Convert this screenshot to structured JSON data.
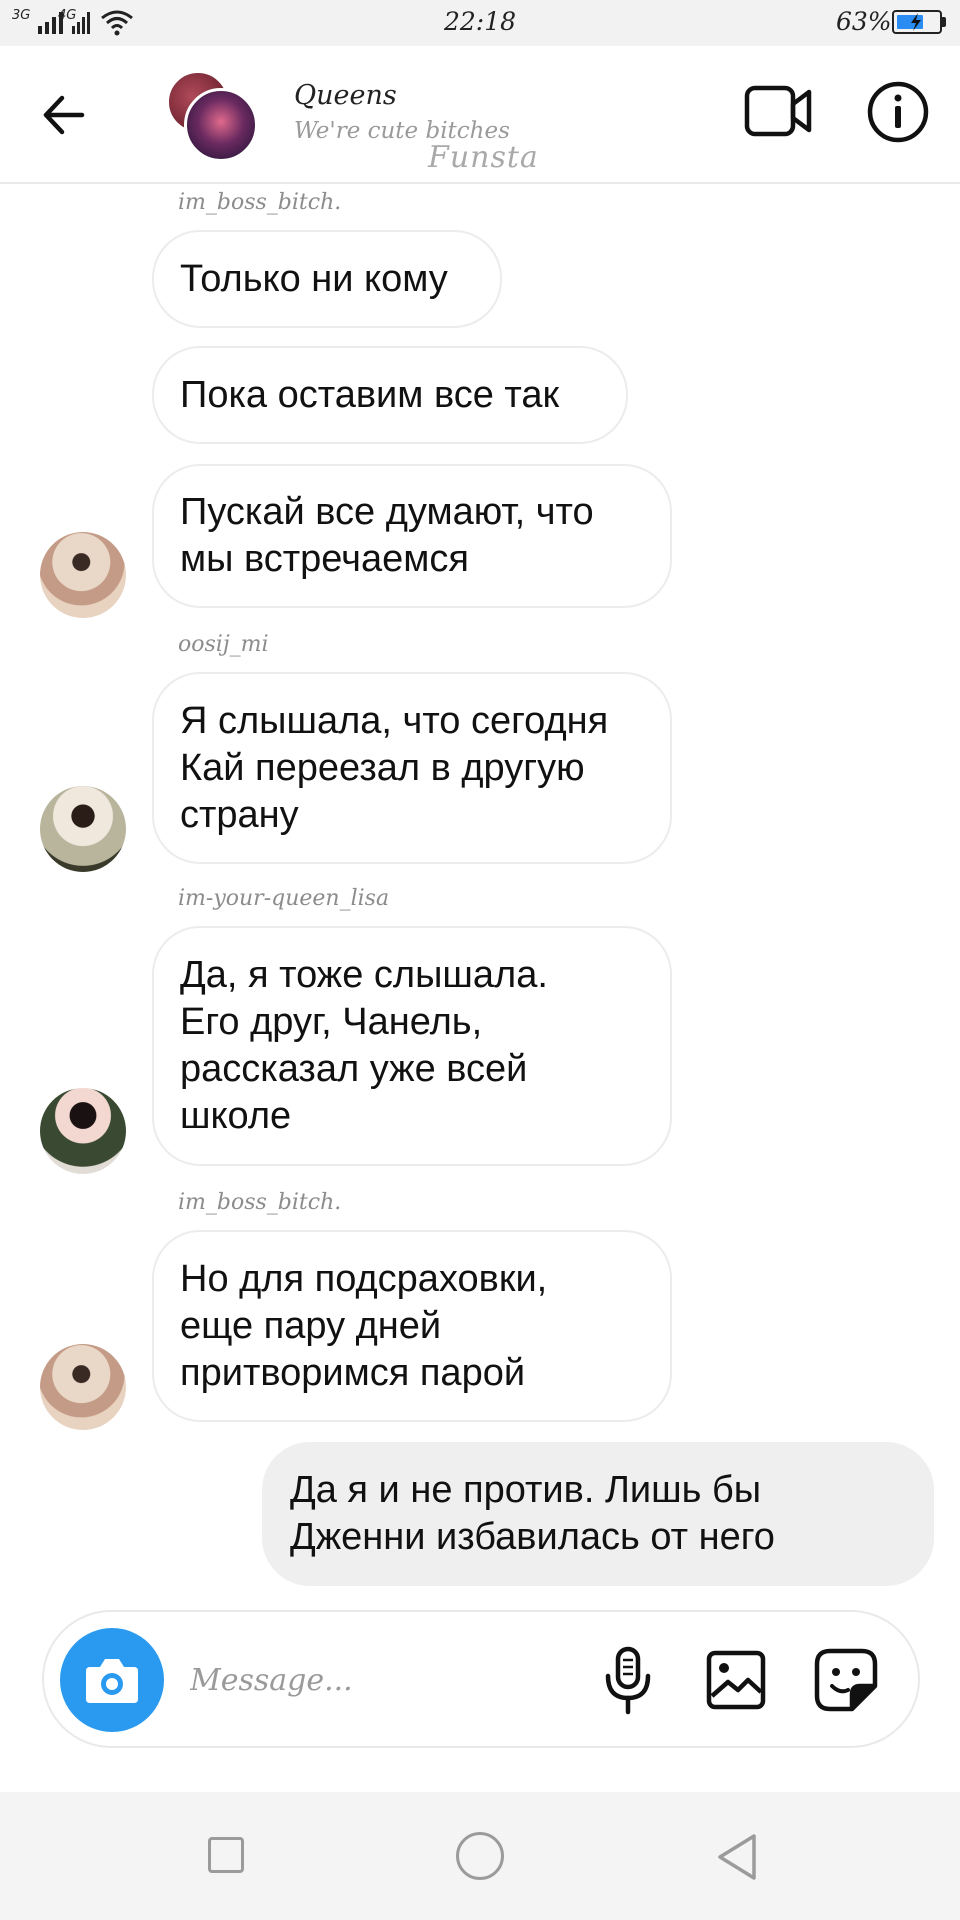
{
  "status_bar": {
    "network_1": "3G",
    "network_2": "4G",
    "time": "22:18",
    "battery_percent": "63%",
    "battery_level": 0.63
  },
  "header": {
    "title": "Queens",
    "subtitle": "We're cute bitches",
    "watermark": "Funsta"
  },
  "messages": [
    {
      "type": "sender",
      "text": "im_boss_bitch."
    },
    {
      "type": "bubble",
      "text": "Только ни кому"
    },
    {
      "type": "bubble",
      "text": "Пока оставим все так"
    },
    {
      "type": "bubble",
      "text": "Пускай все думают, что\nмы встречаемся"
    },
    {
      "type": "sender",
      "text": "oosij_mi"
    },
    {
      "type": "bubble",
      "text": "Я слышала, что сегодня\nКай переезал в другую\nстрану"
    },
    {
      "type": "sender",
      "text": "im-your-queen_lisa"
    },
    {
      "type": "bubble",
      "text": "Да, я тоже слышала.\nЕго друг, Чанель,\nрассказал уже всей\nшколе"
    },
    {
      "type": "sender",
      "text": "im_boss_bitch."
    },
    {
      "type": "bubble",
      "text": "Но для подсраховки,\nеще пару дней\nпритворимся парой"
    },
    {
      "type": "bubble_out",
      "text": "Да я и не против. Лишь бы\nДженни избавилась от него"
    }
  ],
  "composer": {
    "placeholder": "Message..."
  },
  "colors": {
    "accent": "#2a9af0",
    "bubble_in_border": "#ececec",
    "bubble_out_bg": "#efefef"
  },
  "icons": [
    "back-arrow-icon",
    "video-camera-icon",
    "info-icon",
    "camera-icon",
    "microphone-icon",
    "gallery-icon",
    "sticker-icon",
    "recent-apps-icon",
    "home-icon",
    "nav-back-icon"
  ]
}
